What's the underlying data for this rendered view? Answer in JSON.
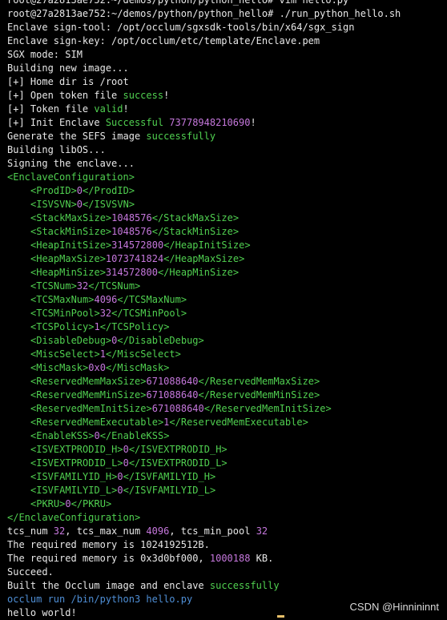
{
  "terminal": {
    "top_line": "root@27a2813ae752:~/demos/python/python_hello# vim hello.py",
    "prompt": "root@27a2813ae752:~/demos/python/python_hello#",
    "command": " ./run_python_hello.sh",
    "l_sign_tool": "Enclave sign-tool: /opt/occlum/sgxsdk-tools/bin/x64/sgx_sign",
    "l_sign_key": "Enclave sign-key: /opt/occlum/etc/template/Enclave.pem",
    "l_sgx_mode": "SGX mode: SIM",
    "l_building": "Building new image...",
    "l_home": "[+] Home dir is /root",
    "l_open_pre": "[+] Open token file ",
    "l_open_hi": "success",
    "l_open_post": "!",
    "l_token_pre": "[+] Token file ",
    "l_token_hi": "valid",
    "l_token_post": "!",
    "l_init_pre": "[+] Init Enclave ",
    "l_init_hi": "Successful",
    "l_init_num": " 73778948210690",
    "l_init_post": "!",
    "l_sefs_pre": "Generate the SEFS image ",
    "l_sefs_hi": "successfully",
    "l_libos": "Building libOS...",
    "l_signing": "Signing the enclave...",
    "cfg_open": "<EnclaveConfiguration>",
    "cfg_close": "</EnclaveConfiguration>",
    "config": [
      {
        "name": "ProdID",
        "value": "0"
      },
      {
        "name": "ISVSVN",
        "value": "0"
      },
      {
        "name": "StackMaxSize",
        "value": "1048576"
      },
      {
        "name": "StackMinSize",
        "value": "1048576"
      },
      {
        "name": "HeapInitSize",
        "value": "314572800"
      },
      {
        "name": "HeapMaxSize",
        "value": "1073741824"
      },
      {
        "name": "HeapMinSize",
        "value": "314572800"
      },
      {
        "name": "TCSNum",
        "value": "32"
      },
      {
        "name": "TCSMaxNum",
        "value": "4096"
      },
      {
        "name": "TCSMinPool",
        "value": "32"
      },
      {
        "name": "TCSPolicy",
        "value": "1"
      },
      {
        "name": "DisableDebug",
        "value": "0"
      },
      {
        "name": "MiscSelect",
        "value": "1"
      },
      {
        "name": "MiscMask",
        "value": "0x0"
      },
      {
        "name": "ReservedMemMaxSize",
        "value": "671088640"
      },
      {
        "name": "ReservedMemMinSize",
        "value": "671088640"
      },
      {
        "name": "ReservedMemInitSize",
        "value": "671088640"
      },
      {
        "name": "ReservedMemExecutable",
        "value": "1"
      },
      {
        "name": "EnableKSS",
        "value": "0"
      },
      {
        "name": "ISVEXTPRODID_H",
        "value": "0"
      },
      {
        "name": "ISVEXTPRODID_L",
        "value": "0"
      },
      {
        "name": "ISVFAMILYID_H",
        "value": "0"
      },
      {
        "name": "ISVFAMILYID_L",
        "value": "0"
      },
      {
        "name": "PKRU",
        "value": "0"
      }
    ],
    "tcs_a": "tcs_num ",
    "tcs_v1": "32",
    "tcs_b": ", tcs_max_num ",
    "tcs_v2": "4096",
    "tcs_c": ", tcs_min_pool ",
    "tcs_v3": "32",
    "mem1": "The required memory is 1024192512B.",
    "mem2_a": "The required memory is 0x3d0bf000, ",
    "mem2_v": "1000188",
    "mem2_b": " KB.",
    "succeed": "Succeed.",
    "built_pre": "Built the Occlum image and enclave ",
    "built_hi": "successfully",
    "run_cmd": "occlum run /bin/python3 hello.py",
    "hello": "hello world!"
  },
  "watermark": "CSDN @Hinnininnt",
  "colors": {
    "background": "#000000",
    "text": "#e8e8e8",
    "green": "#50d050",
    "purple": "#c678dd",
    "blue": "#4f8fd6"
  }
}
